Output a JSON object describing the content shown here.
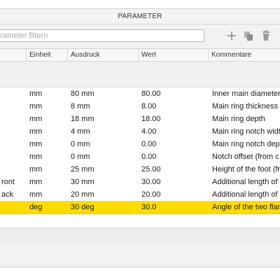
{
  "window": {
    "title": "PARAMETER"
  },
  "toolbar": {
    "filter_placeholder": "Parameter filtern",
    "add_icon": "plus-icon",
    "copy_icon": "copy-icon",
    "delete_icon": "trash-icon"
  },
  "table": {
    "columns": [
      "Einheit",
      "Ausdruck",
      "Wert",
      "Kommentare"
    ],
    "rows": [
      {
        "name": "",
        "unit": "mm",
        "expression": "80 mm",
        "value": "80.00",
        "comment": "Inner main diameter"
      },
      {
        "name": "",
        "unit": "mm",
        "expression": "8 mm",
        "value": "8.00",
        "comment": "Main ring thickness"
      },
      {
        "name": "",
        "unit": "mm",
        "expression": "18 mm",
        "value": "18.00",
        "comment": "Main ring depth"
      },
      {
        "name": "",
        "unit": "mm",
        "expression": "4 mm",
        "value": "4.00",
        "comment": "Main ring notch widt"
      },
      {
        "name": "",
        "unit": "mm",
        "expression": "0 mm",
        "value": "0.00",
        "comment": "Main ring notch dept"
      },
      {
        "name": "",
        "unit": "mm",
        "expression": "0 mm",
        "value": "0.00",
        "comment": "Notch offset (from c"
      },
      {
        "name": "",
        "unit": "mm",
        "expression": "25 mm",
        "value": "25.00",
        "comment": "Height of the foot (fr"
      },
      {
        "name": "ront",
        "unit": "mm",
        "expression": "30 mm",
        "value": "30.00",
        "comment": "Additional length of"
      },
      {
        "name": "ack",
        "unit": "mm",
        "expression": "20 mm",
        "value": "20.00",
        "comment": "Additional length of"
      },
      {
        "name": "",
        "unit": "deg",
        "expression": "30 deg",
        "value": "30.0",
        "comment": "Angle of the two flar",
        "selected": true
      }
    ]
  },
  "colors": {
    "selection": "#ffdc00",
    "border": "#d0d0d0"
  }
}
